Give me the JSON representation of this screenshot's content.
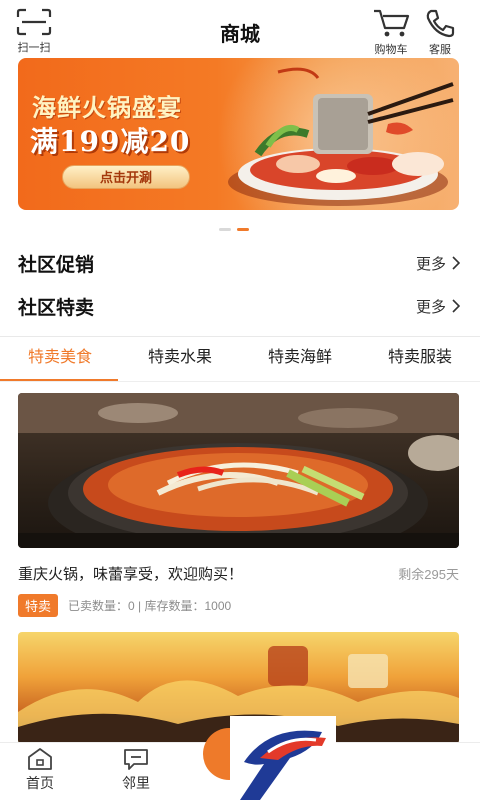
{
  "header": {
    "title": "商城",
    "scan_label": "扫一扫",
    "cart_label": "购物车",
    "service_label": "客服"
  },
  "banner": {
    "title": "海鲜火锅盛宴",
    "promo": "满199减20",
    "button_label": "点击开涮",
    "page_count": 2,
    "active_page": 2
  },
  "sections": [
    {
      "title": "社区促销",
      "more_label": "更多"
    },
    {
      "title": "社区特卖",
      "more_label": "更多"
    }
  ],
  "tabs": [
    {
      "label": "特卖美食",
      "active": true
    },
    {
      "label": "特卖水果",
      "active": false
    },
    {
      "label": "特卖海鲜",
      "active": false
    },
    {
      "label": "特卖服装",
      "active": false
    }
  ],
  "products": [
    {
      "name": "重庆火锅，味蕾享受，欢迎购买！",
      "remaining": "剩余295天",
      "badge": "特卖",
      "meta": "已卖数量：0 | 库存数量：1000"
    }
  ],
  "bottom_nav": [
    {
      "label": "首页",
      "icon": "home-icon"
    },
    {
      "label": "邻里",
      "icon": "chat-icon"
    }
  ],
  "colors": {
    "accent": "#f07a2b",
    "text": "#222222",
    "muted": "#9a9a9a"
  }
}
